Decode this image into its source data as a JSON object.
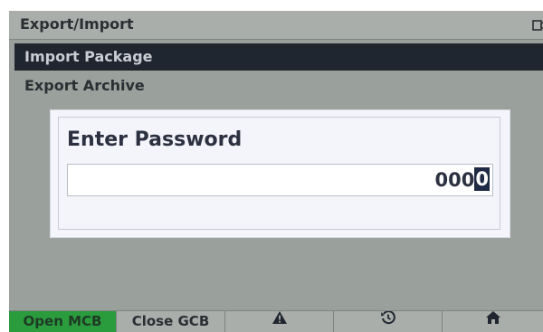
{
  "header": {
    "title": "Export/Import",
    "corner_icon": "window-icon"
  },
  "menu": {
    "items": [
      {
        "label": "Import Package",
        "selected": true
      },
      {
        "label": "Export Archive",
        "selected": false
      }
    ]
  },
  "dialog": {
    "title": "Enter Password",
    "value_prefix": "000",
    "value_cursor": "0"
  },
  "footer": {
    "buttons": [
      {
        "label": "Open MCB",
        "active_color": "#2a9c3e"
      },
      {
        "label": "Close GCB"
      },
      {
        "icon": "warning-icon"
      },
      {
        "icon": "history-icon"
      },
      {
        "icon": "home-icon"
      }
    ]
  }
}
